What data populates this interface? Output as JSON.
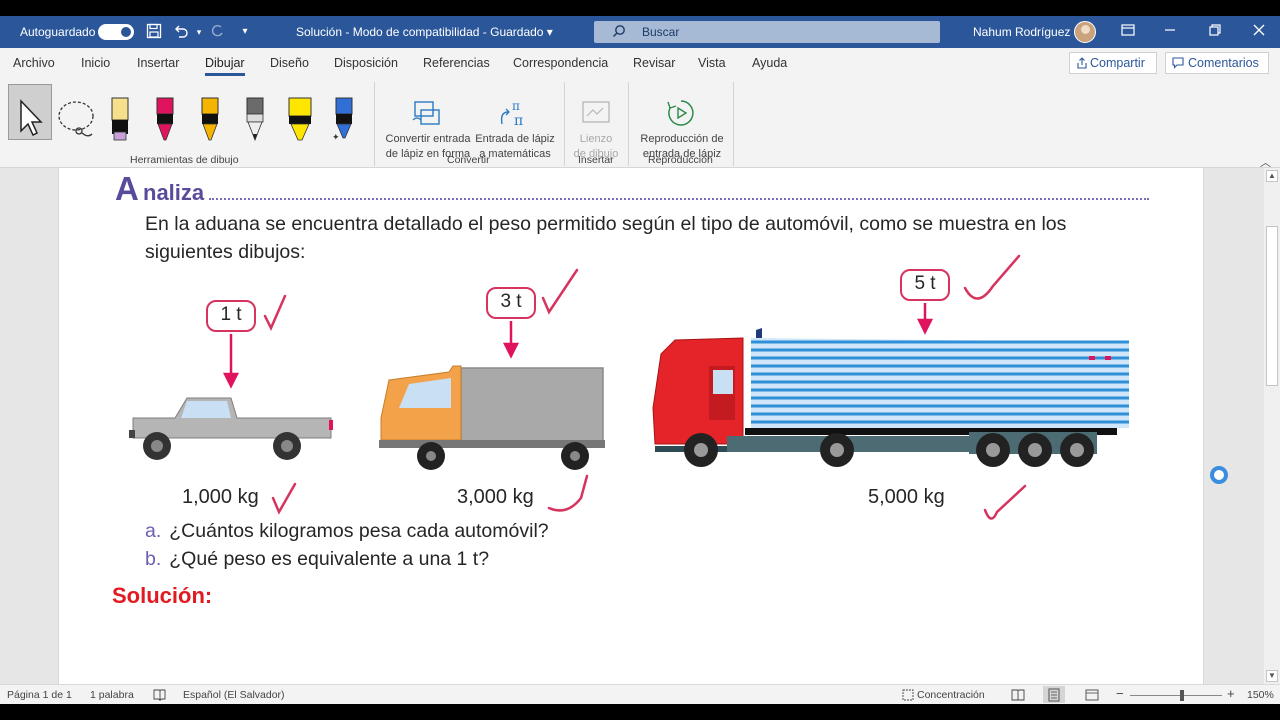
{
  "titlebar": {
    "autosave_label": "Autoguardado",
    "doc_title": "Solución  -  Modo de compatibilidad  -  Guardado  ▾",
    "search_placeholder": "Buscar",
    "user_name": "Nahum Rodríguez"
  },
  "tabs": [
    {
      "label": "Archivo"
    },
    {
      "label": "Inicio"
    },
    {
      "label": "Insertar"
    },
    {
      "label": "Dibujar",
      "active": true
    },
    {
      "label": "Diseño"
    },
    {
      "label": "Disposición"
    },
    {
      "label": "Referencias"
    },
    {
      "label": "Correspondencia"
    },
    {
      "label": "Revisar"
    },
    {
      "label": "Vista"
    },
    {
      "label": "Ayuda"
    }
  ],
  "share_label": "Compartir",
  "comments_label": "Comentarios",
  "ribbon": {
    "groups": {
      "drawing_tools": "Herramientas de dibujo",
      "convert": "Convertir",
      "insert": "Insertar",
      "replay": "Reproducción"
    },
    "buttons": {
      "ink_to_shape_l1": "Convertir entrada",
      "ink_to_shape_l2": "de lápiz en forma",
      "ink_to_math_l1": "Entrada de lápiz",
      "ink_to_math_l2": "a matemáticas",
      "canvas_l1": "Lienzo",
      "canvas_l2": "de dibujo",
      "ink_replay_l1": "Reproducción de",
      "ink_replay_l2": "entrada de lápiz"
    },
    "pen_colors": [
      "#f6e08c",
      "#e0135f",
      "#f5b400",
      "#6b6b6b",
      "#ffe600",
      "#2f6fd6"
    ]
  },
  "document": {
    "heading_first": "A",
    "heading_rest": "naliza",
    "paragraph": "En la aduana se encuentra detallado el peso permitido según el tipo de automóvil, como se muestra en los siguientes dibujos:",
    "labels": [
      "1 t",
      "3 t",
      "5 t"
    ],
    "weights": [
      "1,000 kg",
      "3,000 kg",
      "5,000 kg"
    ],
    "questions": [
      {
        "letter": "a.",
        "text": "¿Cuántos kilogramos pesa cada automóvil?"
      },
      {
        "letter": "b.",
        "text": "¿Qué peso es equivalente a una 1 t?"
      }
    ],
    "solution_label": "Solución:"
  },
  "statusbar": {
    "page": "Página 1 de 1",
    "words": "1 palabra",
    "language": "Español (El Salvador)",
    "focus": "Concentración",
    "zoom": "150%"
  },
  "colors": {
    "word_blue": "#2b579a",
    "ink_pink": "#d6335e",
    "heading_purple": "#5a4a9c",
    "solution_red": "#e11b22"
  }
}
